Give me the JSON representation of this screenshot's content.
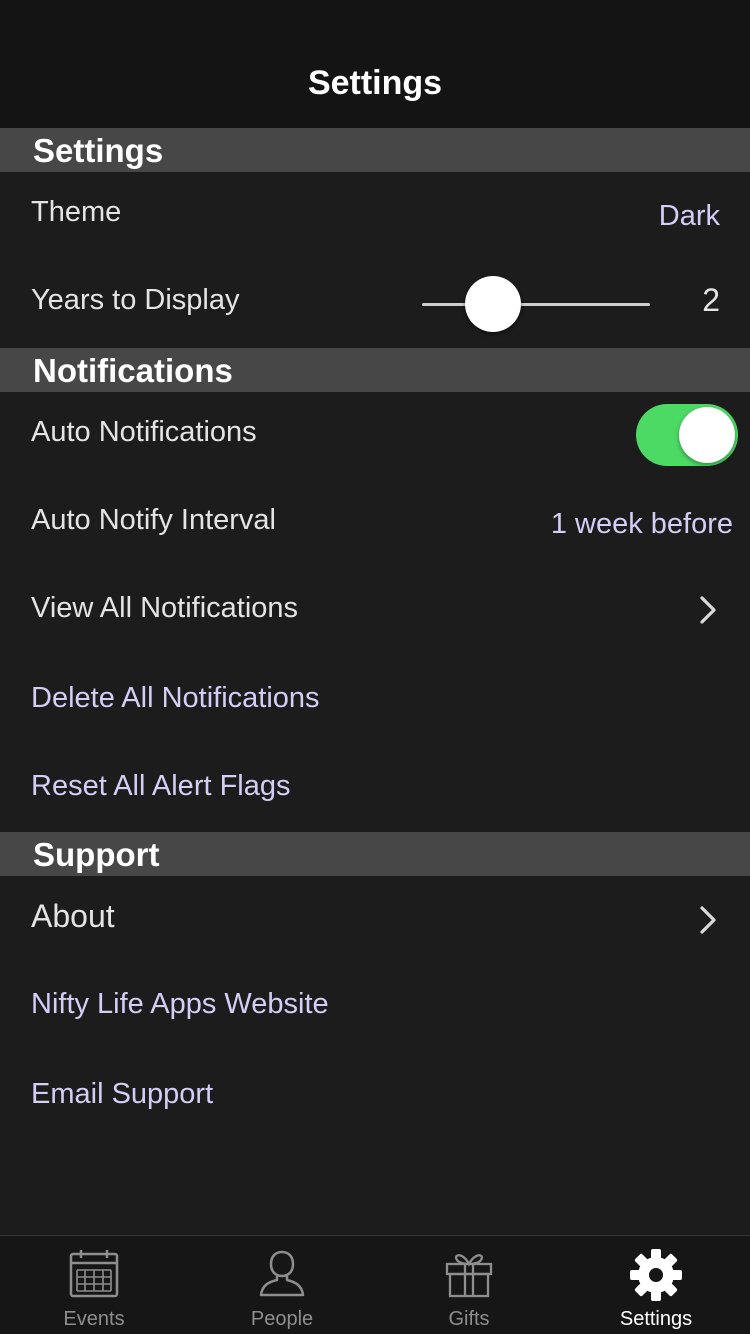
{
  "nav": {
    "title": "Settings"
  },
  "sections": {
    "settings": {
      "header": "Settings"
    },
    "notifications": {
      "header": "Notifications"
    },
    "support": {
      "header": "Support"
    }
  },
  "settings": {
    "theme": {
      "label": "Theme",
      "value": "Dark"
    },
    "years": {
      "label": "Years to Display",
      "value": "2",
      "slider_fraction": 0.31
    }
  },
  "notifications": {
    "auto": {
      "label": "Auto Notifications",
      "enabled": true
    },
    "interval": {
      "label": "Auto Notify Interval",
      "value": "1 week before"
    },
    "view_all": {
      "label": "View All Notifications"
    },
    "delete_all": {
      "label": "Delete All Notifications"
    },
    "reset_flags": {
      "label": "Reset All Alert Flags"
    }
  },
  "support": {
    "about": {
      "label": "About"
    },
    "website": {
      "label": "Nifty Life Apps Website"
    },
    "email": {
      "label": "Email Support"
    }
  },
  "tabs": [
    {
      "label": "Events",
      "icon": "calendar-icon",
      "active": false
    },
    {
      "label": "People",
      "icon": "person-icon",
      "active": false
    },
    {
      "label": "Gifts",
      "icon": "gift-icon",
      "active": false
    },
    {
      "label": "Settings",
      "icon": "gear-icon",
      "active": true
    }
  ],
  "colors": {
    "accent": "#d4cdf5",
    "toggle_on": "#4cd964",
    "background": "#1c1c1c",
    "section_header": "#474747"
  }
}
